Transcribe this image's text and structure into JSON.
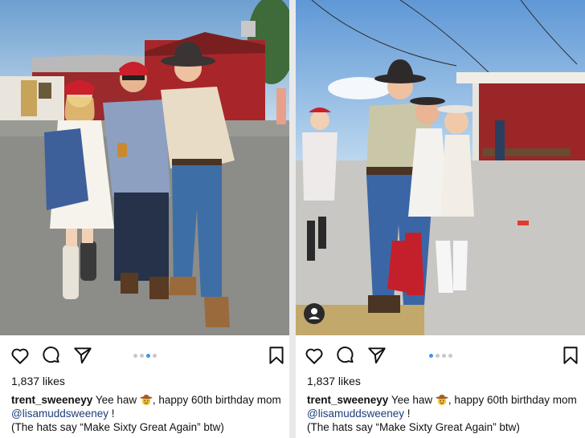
{
  "posts": [
    {
      "likes": "1,837 likes",
      "username": "trent_sweeneyy",
      "caption_part1": "Yee haw",
      "caption_part2": ", happy 60th birthday mom",
      "mention": "@lisamuddsweeney",
      "caption_part3": " !",
      "note": "(The hats say “Make Sixty Great Again” btw)",
      "carousel_total": 4,
      "carousel_active": 3,
      "icons": [
        "heart-icon",
        "comment-icon",
        "share-icon",
        "bookmark-icon"
      ]
    },
    {
      "likes": "1,837 likes",
      "username": "trent_sweeneyy",
      "caption_part1": "Yee haw",
      "caption_part2": ", happy 60th birthday mom",
      "mention": "@lisamuddsweeney",
      "caption_part3": " !",
      "note": "(The hats say “Make Sixty Great Again” btw)",
      "carousel_total": 4,
      "carousel_active": 1,
      "icons": [
        "heart-icon",
        "comment-icon",
        "share-icon",
        "bookmark-icon",
        "user-tag-icon"
      ]
    }
  ],
  "colors": {
    "active_dot": "#3897f0",
    "inactive_dot": "#c8c8c8",
    "mention": "#1c3e7a",
    "barn_red": "#a8262a"
  }
}
